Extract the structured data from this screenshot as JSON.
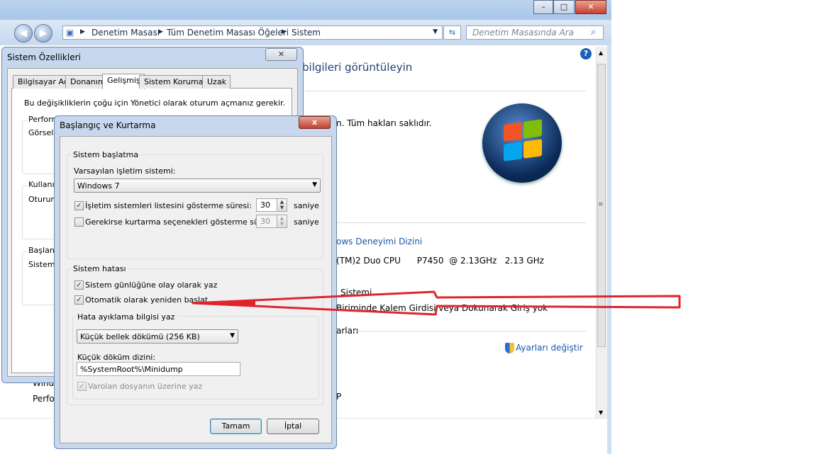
{
  "explorer": {
    "breadcrumb": [
      "Denetim Masası",
      "Tüm Denetim Masası Öğeleri",
      "Sistem"
    ],
    "search_placeholder": "Denetim Masasında Ara",
    "heading": "bilgileri görüntüleyin",
    "copyright": "n. Tüm hakları saklıdır.",
    "rating_link": "ows Deneyimi Dizini",
    "processor": "(TM)2 Duo CPU      P7450  @ 2.13GHz   2.13 GHz",
    "system_type": "Sistemi",
    "pen_touch": "Biriminde Kalem Girdisi veya Dokunarak Giriş yok",
    "section": "arları",
    "change_settings": "Ayarları değiştir",
    "letter_p": "P",
    "bottom1": "Windo",
    "bottom2": "Perfo"
  },
  "sysprops": {
    "title": "Sistem Özellikleri",
    "tabs": [
      "Bilgisayar Adı",
      "Donanım",
      "Gelişmiş",
      "Sistem Koruması",
      "Uzak"
    ],
    "admin_note": "Bu değişikliklerin çoğu için Yönetici olarak oturum açmanız gerekir.",
    "group1": "Perform",
    "group1_text": "Görsel e",
    "group2": "Kullanıcı",
    "group2_text": "Oturum",
    "group3": "Başlang",
    "group3_text": "Sistem"
  },
  "startup": {
    "title": "Başlangıç ve Kurtarma",
    "close": "x",
    "startup_group": "Sistem başlatma",
    "default_os_label": "Varsayılan işletim sistemi:",
    "default_os_value": "Windows 7",
    "show_list_label": "İşletim sistemleri listesini gösterme süresi:",
    "show_list_value": "30",
    "show_recovery_label": "Gerekirse kurtarma seçenekleri gösterme süresi:",
    "show_recovery_value": "30",
    "unit": "saniye",
    "failure_group": "Sistem hatası",
    "write_event": "Sistem günlüğüne olay olarak yaz",
    "auto_restart": "Otomatik olarak yeniden başlat",
    "debug_group": "Hata ayıklama bilgisi yaz",
    "debug_value": "Küçük bellek dökümü (256 KB)",
    "dump_dir_label": "Küçük döküm dizini:",
    "dump_dir_value": "%SystemRoot%\\Minidump",
    "overwrite": "Varolan dosyanın üzerine yaz",
    "ok": "Tamam",
    "cancel": "İptal"
  },
  "colors": {
    "annotation": "#e0242c",
    "link": "#1a57a8"
  }
}
